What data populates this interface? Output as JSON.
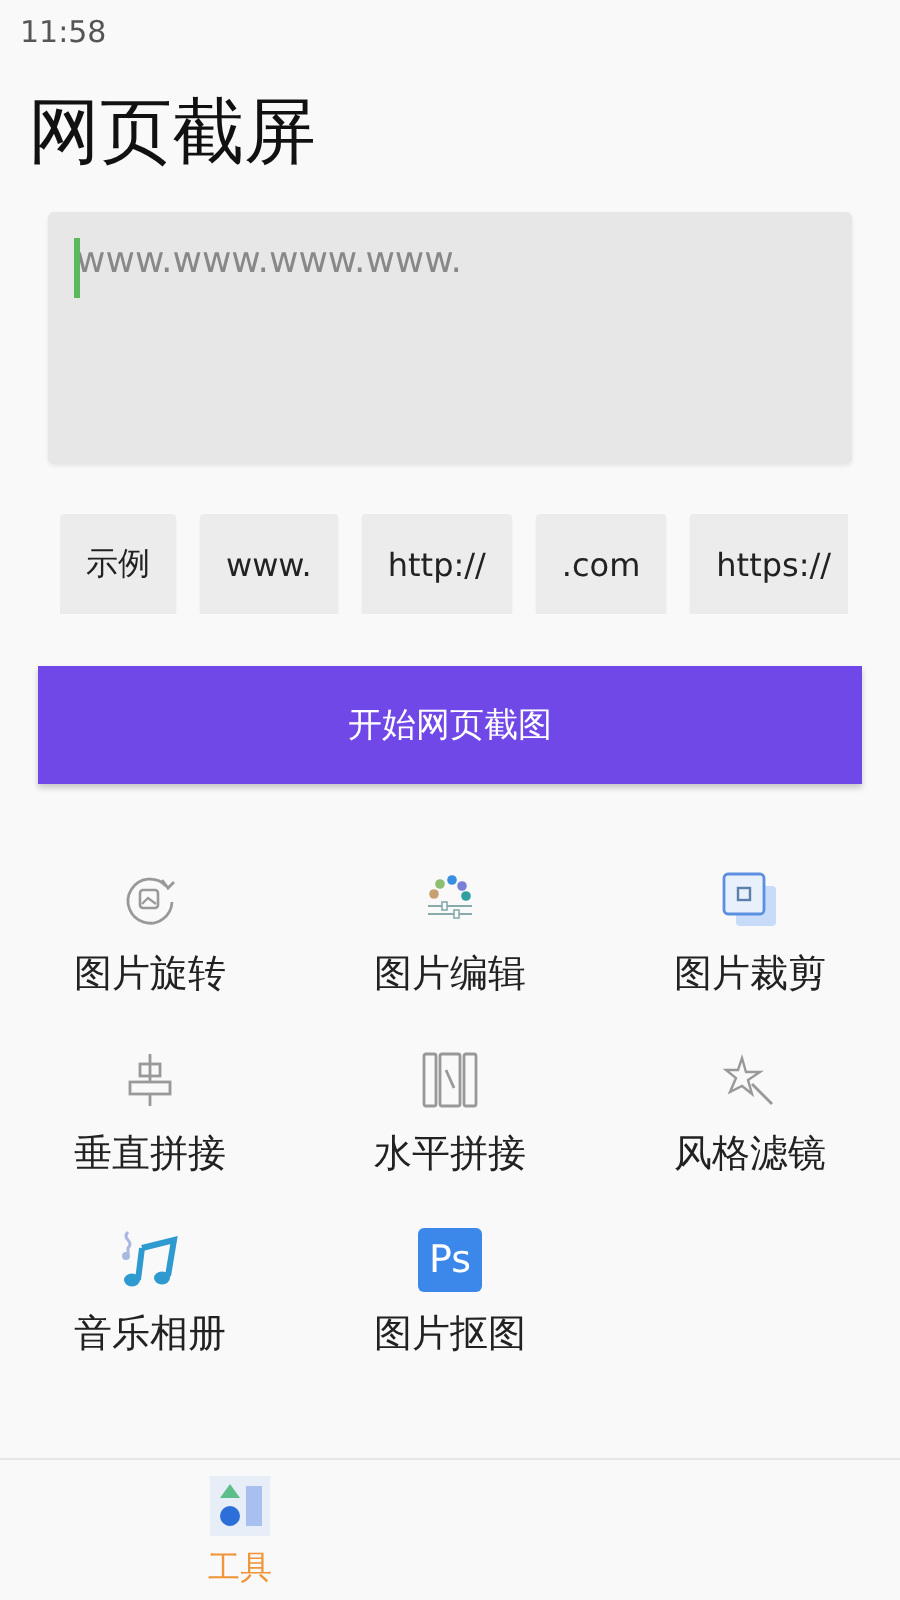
{
  "status_bar": {
    "time": "11:58"
  },
  "title": "网页截屏",
  "url_field": {
    "placeholder": "www.www.www.www."
  },
  "chips": [
    "示例",
    "www.",
    "http://",
    ".com",
    "https://"
  ],
  "start_button": "开始网页截图",
  "tools": [
    {
      "kind": "rotate",
      "label": "图片旋转"
    },
    {
      "kind": "edit",
      "label": "图片编辑"
    },
    {
      "kind": "crop",
      "label": "图片裁剪"
    },
    {
      "kind": "vertical",
      "label": "垂直拼接"
    },
    {
      "kind": "horizontal",
      "label": "水平拼接"
    },
    {
      "kind": "filter",
      "label": "风格滤镜"
    },
    {
      "kind": "music",
      "label": "音乐相册"
    },
    {
      "kind": "ps",
      "label": "图片抠图",
      "icon_text": "Ps"
    }
  ],
  "bottom_nav": [
    {
      "label": "工具",
      "selected": true
    }
  ]
}
